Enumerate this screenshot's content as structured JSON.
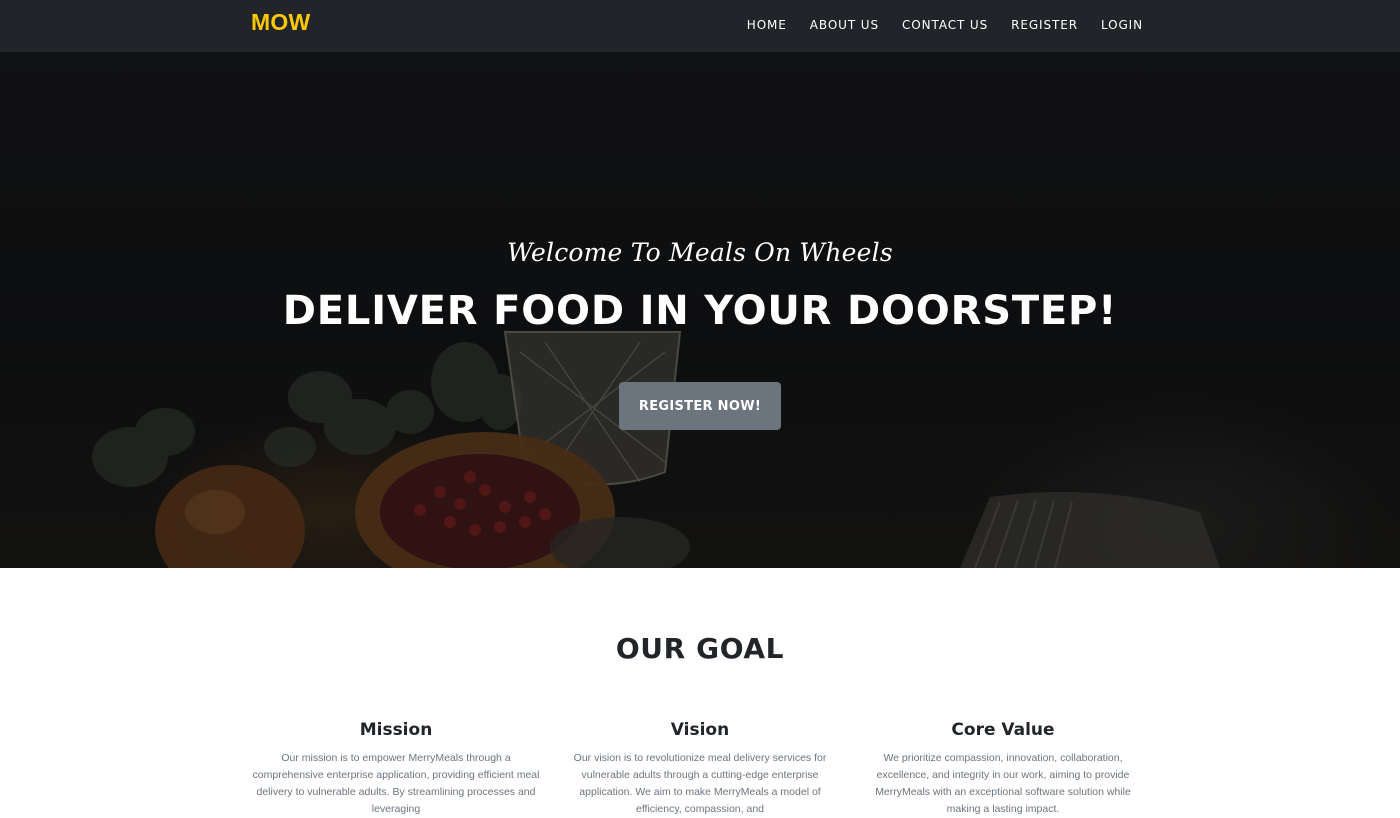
{
  "nav": {
    "brand": "MOW",
    "links": [
      "HOME",
      "ABOUT US",
      "CONTACT US",
      "REGISTER",
      "LOGIN"
    ]
  },
  "hero": {
    "subtitle": "Welcome To Meals On Wheels",
    "title": "DELIVER FOOD IN YOUR DOORSTEP!",
    "button_label": "REGISTER NOW!"
  },
  "goal": {
    "heading": "OUR GOAL",
    "columns": [
      {
        "title": "Mission",
        "text": "Our mission is to empower MerryMeals through a comprehensive enterprise application, providing efficient meal delivery to vulnerable adults. By streamlining processes and leveraging"
      },
      {
        "title": "Vision",
        "text": "Our vision is to revolutionize meal delivery services for vulnerable adults through a cutting-edge enterprise application. We aim to make MerryMeals a model of efficiency, compassion, and"
      },
      {
        "title": "Core Value",
        "text": "We prioritize compassion, innovation, collaboration, excellence, and integrity in our work, aiming to provide MerryMeals with an exceptional software solution while making a lasting impact."
      }
    ]
  },
  "colors": {
    "navbar_bg": "#212529",
    "brand": "#ffc800",
    "button_bg": "#6c757d",
    "body_text": "#6c757d"
  }
}
